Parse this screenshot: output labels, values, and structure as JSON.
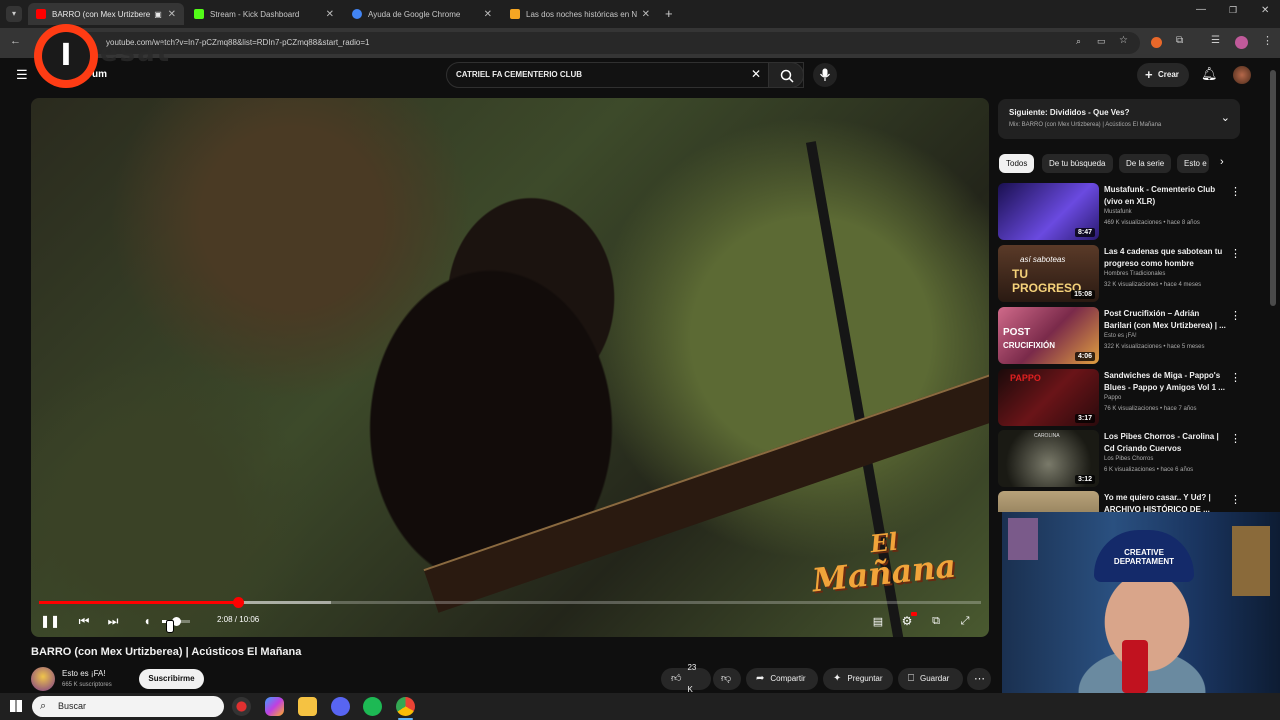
{
  "browser": {
    "tabs": [
      {
        "label": "BARRO (con Mex Urtizbere",
        "favicon_color": "#ff0000",
        "active": true
      },
      {
        "label": "Stream - Kick Dashboard",
        "favicon_color": "#53fc18",
        "active": false
      },
      {
        "label": "Ayuda de Google Chrome",
        "favicon_color": "#4285f4",
        "active": false
      },
      {
        "label": "Las dos noches históricas en N",
        "favicon_color": "#f5a623",
        "active": false
      }
    ],
    "url": "youtube.com/watch?v=In7-pCZmq88&list=RDIn7-pCZmq88&start_radio=1"
  },
  "youtube": {
    "logo_suffix": "um",
    "search_query": "CATRIEL FA CEMENTERIO CLUB",
    "create_label": "Crear"
  },
  "overlay": {
    "brand_letter": "I",
    "brand_text": "esat"
  },
  "video": {
    "title": "BARRO (con Mex Urtizberea) | Acústicos El Mañana",
    "logo_line1": "El",
    "logo_line2": "Mañana",
    "current_time": "2:08",
    "duration": "10:06",
    "time_display": "2:08 / 10:06",
    "played_fraction": 0.211,
    "buffered_fraction": 0.31,
    "volume_fraction": 0.5
  },
  "channel": {
    "name": "Esto es ¡FA!",
    "subscribers": "665 K suscriptores",
    "subscribe_label": "Suscribirme"
  },
  "actions": {
    "likes": "23 K",
    "share": "Compartir",
    "ask": "Preguntar",
    "save": "Guardar"
  },
  "playlist": {
    "next_title": "Siguiente: Divididos - Que Ves?",
    "next_sub": "Mix: BARRO (con Mex Urtizberea) | Acústicos El Mañana"
  },
  "chips": [
    "Todos",
    "De tu búsqueda",
    "De la serie",
    "Esto e"
  ],
  "recommendations": [
    {
      "title": "Mustafunk - Cementerio Club (vivo en XLR)",
      "channel": "Mustafunk",
      "meta": "469 K visualizaciones • hace 8 años",
      "duration": "8:47",
      "thumb_color": "#3a2a8a"
    },
    {
      "title": "Las 4 cadenas que sabotean tu progreso como hombre",
      "channel": "Hombres Tradicionales",
      "meta": "32 K visualizaciones • hace 4 meses",
      "duration": "15:08",
      "thumb_color": "#3a2418",
      "thumb_text_1": "así saboteas",
      "thumb_text_2": "TU PROGRESO"
    },
    {
      "title": "Post Crucifixión – Adrián Barilari (con Mex Urtizberea) | ...",
      "channel": "Esto es ¡FA!",
      "meta": "322 K visualizaciones • hace 5 meses",
      "duration": "4:06",
      "thumb_color": "#a03a5a",
      "thumb_text_1": "POST",
      "thumb_text_2": "CRUCIFIXIÓN"
    },
    {
      "title": "Sandwiches de Miga - Pappo's Blues - Pappo y Amigos Vol 1 ...",
      "channel": "Pappo",
      "meta": "76 K visualizaciones • hace 7 años",
      "duration": "3:17",
      "thumb_color": "#4a0e12",
      "thumb_text_1": "PAPPO"
    },
    {
      "title": "Los Pibes Chorros - Carolina | Cd Criando Cuervos",
      "channel": "Los Pibes Chorros",
      "meta": "6 K visualizaciones • hace 6 años",
      "duration": "3:12",
      "thumb_color": "#2a2a22",
      "thumb_text_1": "CAROLINA"
    },
    {
      "title": "Yo me quiero casar.. Y Ud? | ARCHIVO HISTÓRICO DE ...",
      "channel": "",
      "meta": "",
      "duration": "",
      "thumb_color": "#8a7a5a"
    }
  ],
  "webcam": {
    "cap_line1": "CREATIVE",
    "cap_line2": "DEPARTAMENT"
  },
  "taskbar": {
    "search_label": "Buscar"
  }
}
